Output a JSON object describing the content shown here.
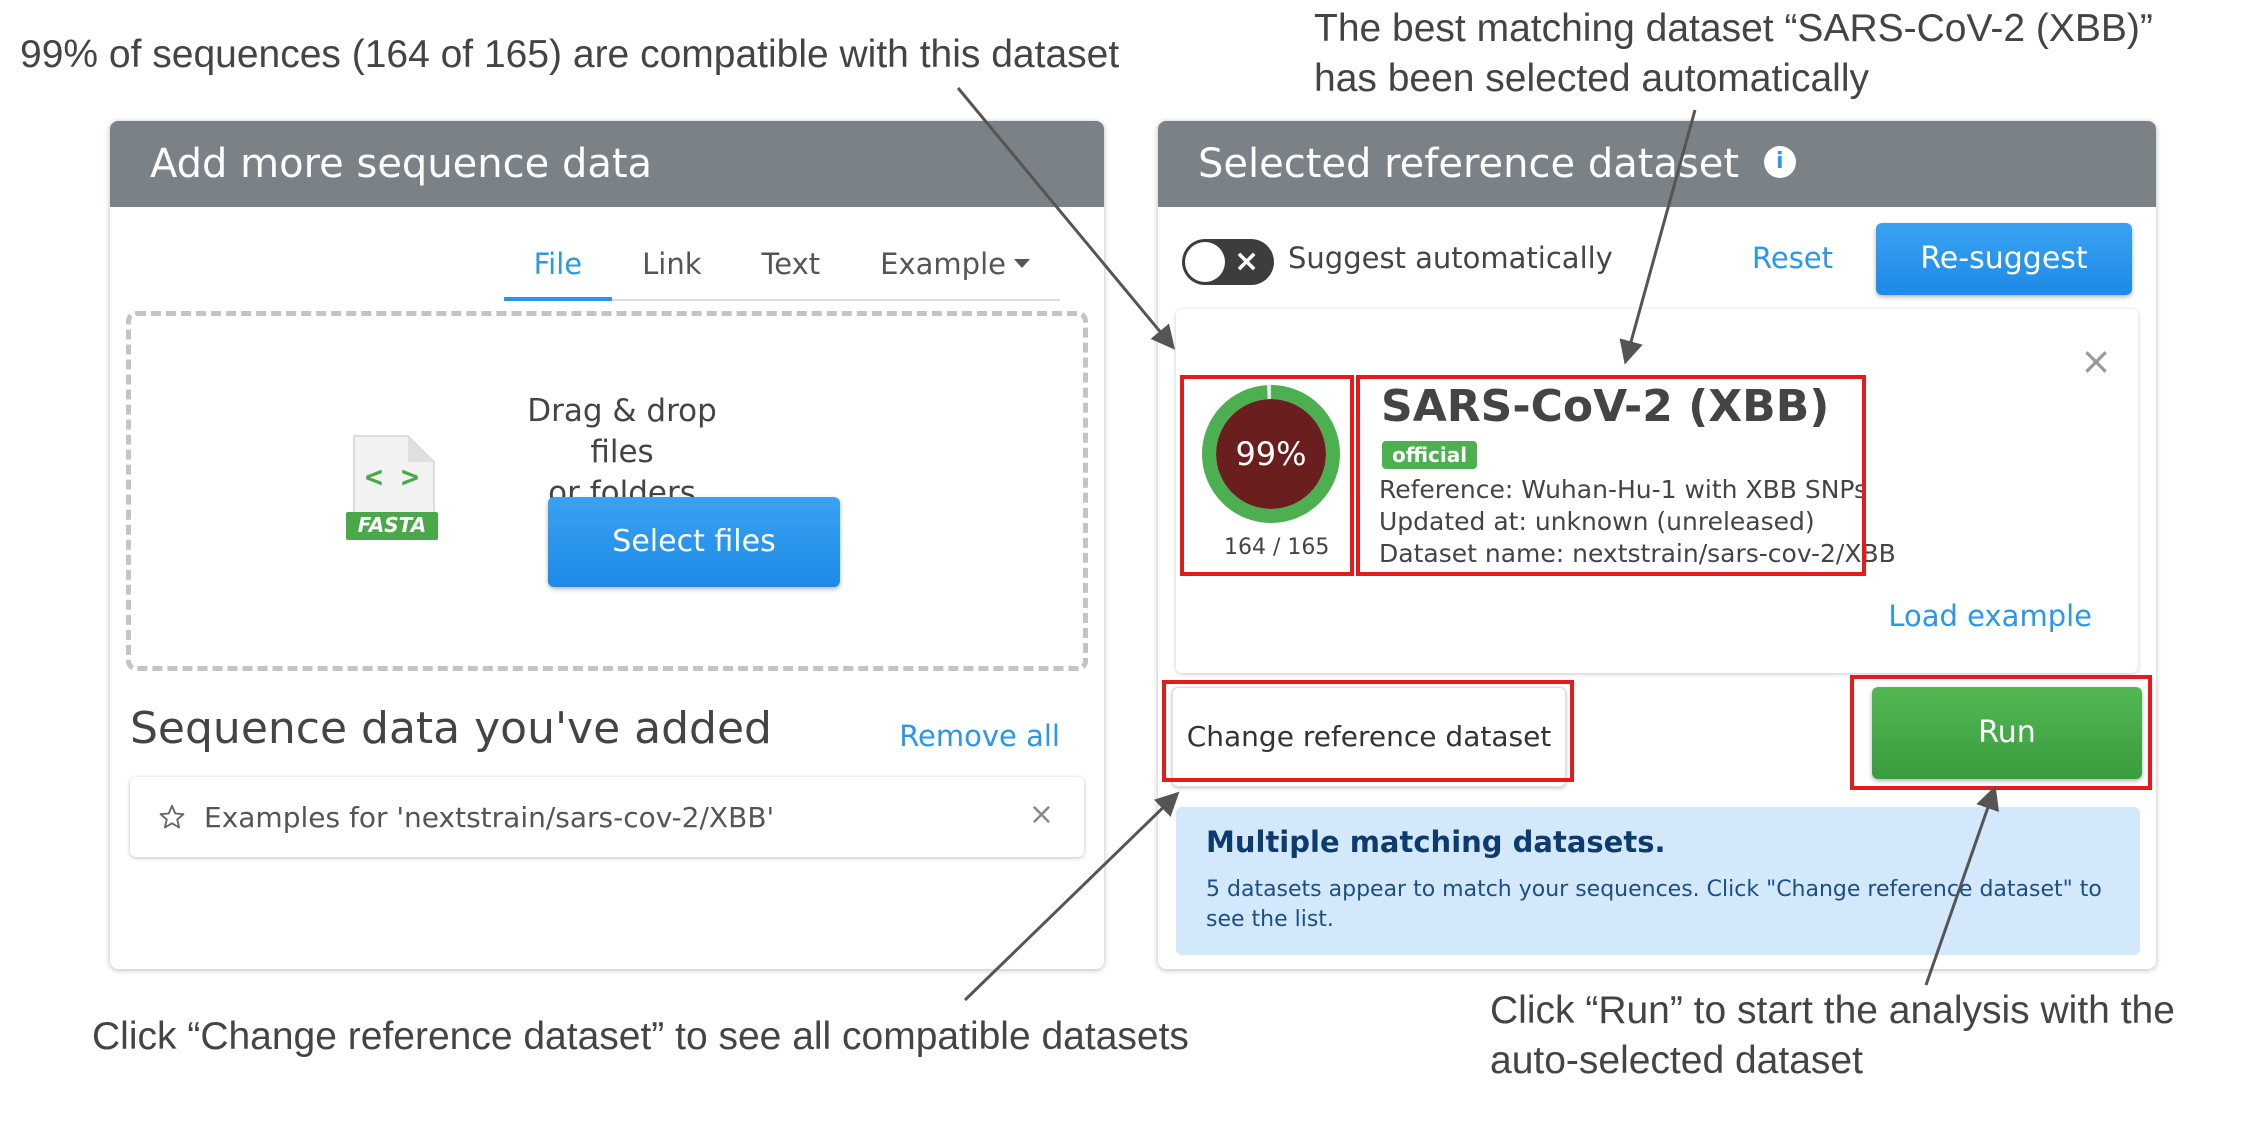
{
  "annotations": {
    "compat_note": "99% of sequences (164 of 165) are compatible with this dataset",
    "best_match_line1": "The best matching dataset “SARS-CoV-2 (XBB)”",
    "best_match_line2": "has been selected automatically",
    "change_note": "Click “Change reference dataset” to see all compatible datasets",
    "run_note_line1": "Click “Run” to start the analysis with the",
    "run_note_line2": "auto-selected dataset"
  },
  "left_panel": {
    "title": "Add more sequence data",
    "tabs": [
      {
        "label": "File",
        "active": true
      },
      {
        "label": "Link",
        "active": false
      },
      {
        "label": "Text",
        "active": false
      },
      {
        "label": "Example",
        "active": false
      }
    ],
    "file_icon_label": "FASTA",
    "file_icon_glyph": "< >",
    "drop_line1": "Drag & drop files",
    "drop_line2": "or folders",
    "select_files_label": "Select files",
    "section_title": "Sequence data you've added",
    "remove_all_label": "Remove all",
    "items": [
      {
        "label": "Examples for 'nextstrain/sars-cov-2/XBB'",
        "icon": "star-icon"
      }
    ]
  },
  "right_panel": {
    "title": "Selected reference dataset",
    "info_icon": "i",
    "suggest_label": "Suggest automatically",
    "reset_label": "Reset",
    "resuggest_label": "Re-suggest",
    "dataset": {
      "name": "SARS-CoV-2 (XBB)",
      "badge": "official",
      "reference": "Reference: Wuhan-Hu-1 with XBB SNPs",
      "updated": "Updated at: unknown (unreleased)",
      "dataset_name": "Dataset name: nextstrain/sars-cov-2/XBB",
      "percent_label": "99%",
      "count_label": "164 / 165",
      "compatible_fraction": 0.99
    },
    "load_example_label": "Load example",
    "change_dataset_label": "Change reference dataset",
    "run_label": "Run",
    "alert": {
      "title": "Multiple matching datasets.",
      "body": "5 datasets appear to match your sequences. Click \"Change reference dataset\" to see the list."
    }
  },
  "colors": {
    "accent_blue": "#2a97e8",
    "header_gray": "#7a8187",
    "ring_green": "#4caf50",
    "ring_center": "#6b1e1e",
    "highlight_red": "#e51b1b",
    "run_green": "#4caf50"
  }
}
